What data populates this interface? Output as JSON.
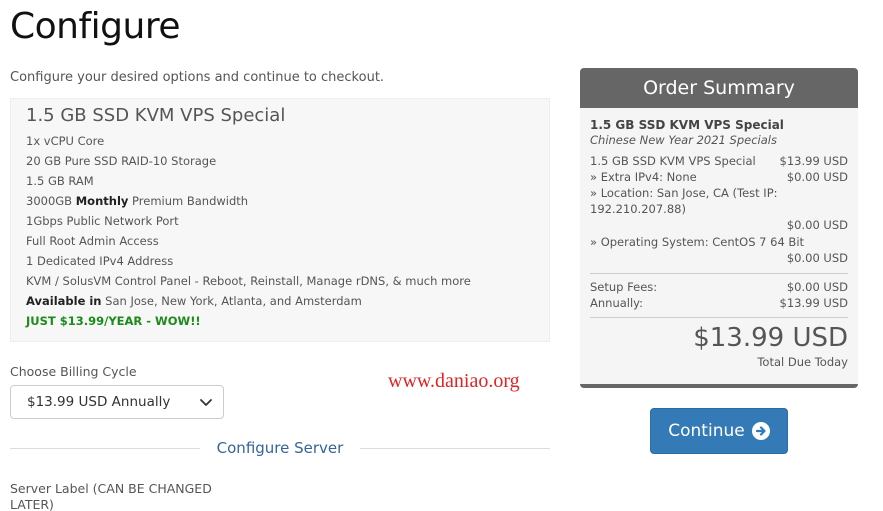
{
  "page": {
    "title": "Configure",
    "intro": "Configure your desired options and continue to checkout."
  },
  "product": {
    "name": "1.5 GB SSD KVM VPS Special",
    "features": [
      "1x vCPU Core",
      "20 GB Pure SSD RAID-10 Storage",
      "1.5 GB RAM"
    ],
    "bandwidth_pre": "3000GB ",
    "bandwidth_bold": "Monthly",
    "bandwidth_post": " Premium Bandwidth",
    "features2": [
      "1Gbps Public Network Port",
      "Full Root Admin Access",
      "1 Dedicated IPv4 Address",
      "KVM / SolusVM Control Panel - Reboot, Reinstall, Manage rDNS, & much more"
    ],
    "available_bold": "Available in",
    "available_text": " San Jose, New York, Atlanta, and Amsterdam",
    "promo": "JUST $13.99/YEAR - WOW!!"
  },
  "billing": {
    "label": "Choose Billing Cycle",
    "selected": "$13.99 USD Annually"
  },
  "watermark": "www.daniao.org",
  "configure_server": {
    "title": "Configure Server",
    "server_label": "Server Label (CAN BE CHANGED LATER)"
  },
  "summary": {
    "header": "Order Summary",
    "product": "1.5 GB SSD KVM VPS Special",
    "group": "Chinese New Year 2021 Specials",
    "line_item": {
      "label": "1.5 GB SSD KVM VPS Special",
      "amount": "$13.99 USD"
    },
    "extra_ipv4": {
      "label": "» Extra IPv4: None",
      "amount": "$0.00 USD"
    },
    "location": {
      "label": "» Location: San Jose, CA (Test IP: 192.210.207.88)",
      "amount": "$0.00 USD"
    },
    "os": {
      "label": "» Operating System: CentOS 7 64 Bit",
      "amount": "$0.00 USD"
    },
    "setup_fees": {
      "label": "Setup Fees:",
      "amount": "$0.00 USD"
    },
    "annually": {
      "label": "Annually:",
      "amount": "$13.99 USD"
    },
    "total": "$13.99 USD",
    "total_label": "Total Due Today"
  },
  "continue_button": {
    "label": "Continue"
  },
  "colors": {
    "accent": "#337ab7",
    "summary_header": "#666666",
    "promo_green": "#1d8a1d",
    "watermark_red": "#e02424",
    "section_title": "#336699"
  },
  "icons": {
    "select_chevron": "chevron-down-icon",
    "continue_arrow": "arrow-circle-right-icon"
  }
}
